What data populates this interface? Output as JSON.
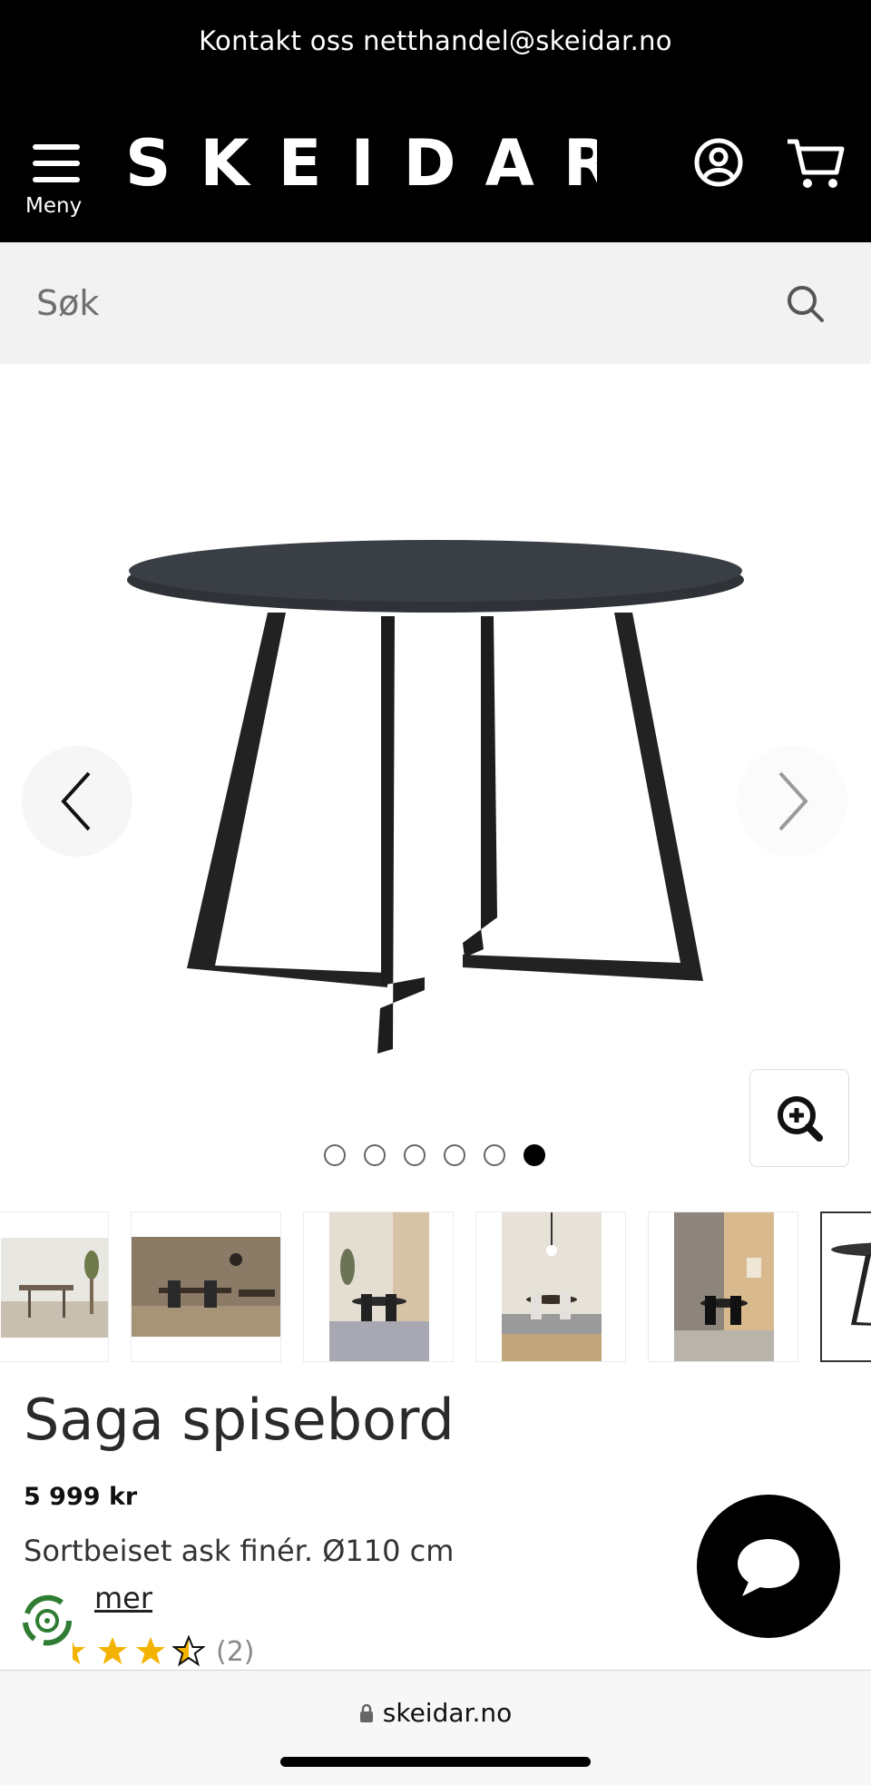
{
  "header": {
    "contact_text": "Kontakt oss netthandel@skeidar.no",
    "menu_label": "Meny",
    "logo_text": "SKEIDAR"
  },
  "search": {
    "placeholder": "Søk"
  },
  "gallery": {
    "slide_count": 6,
    "active_slide_index": 6,
    "thumbnail_count": 6
  },
  "product": {
    "title": "Saga spisebord",
    "price": "5 999 kr",
    "description": "Sortbeiset ask finér. Ø110 cm",
    "more_link": "mer",
    "rating_value": 3.5,
    "rating_max": 5,
    "review_count": "(2)"
  },
  "browser": {
    "url": "skeidar.no"
  },
  "colors": {
    "header_bg": "#000000",
    "search_bg": "#f2f2f2",
    "star": "#f5b301",
    "eco_green": "#2e7d32"
  }
}
